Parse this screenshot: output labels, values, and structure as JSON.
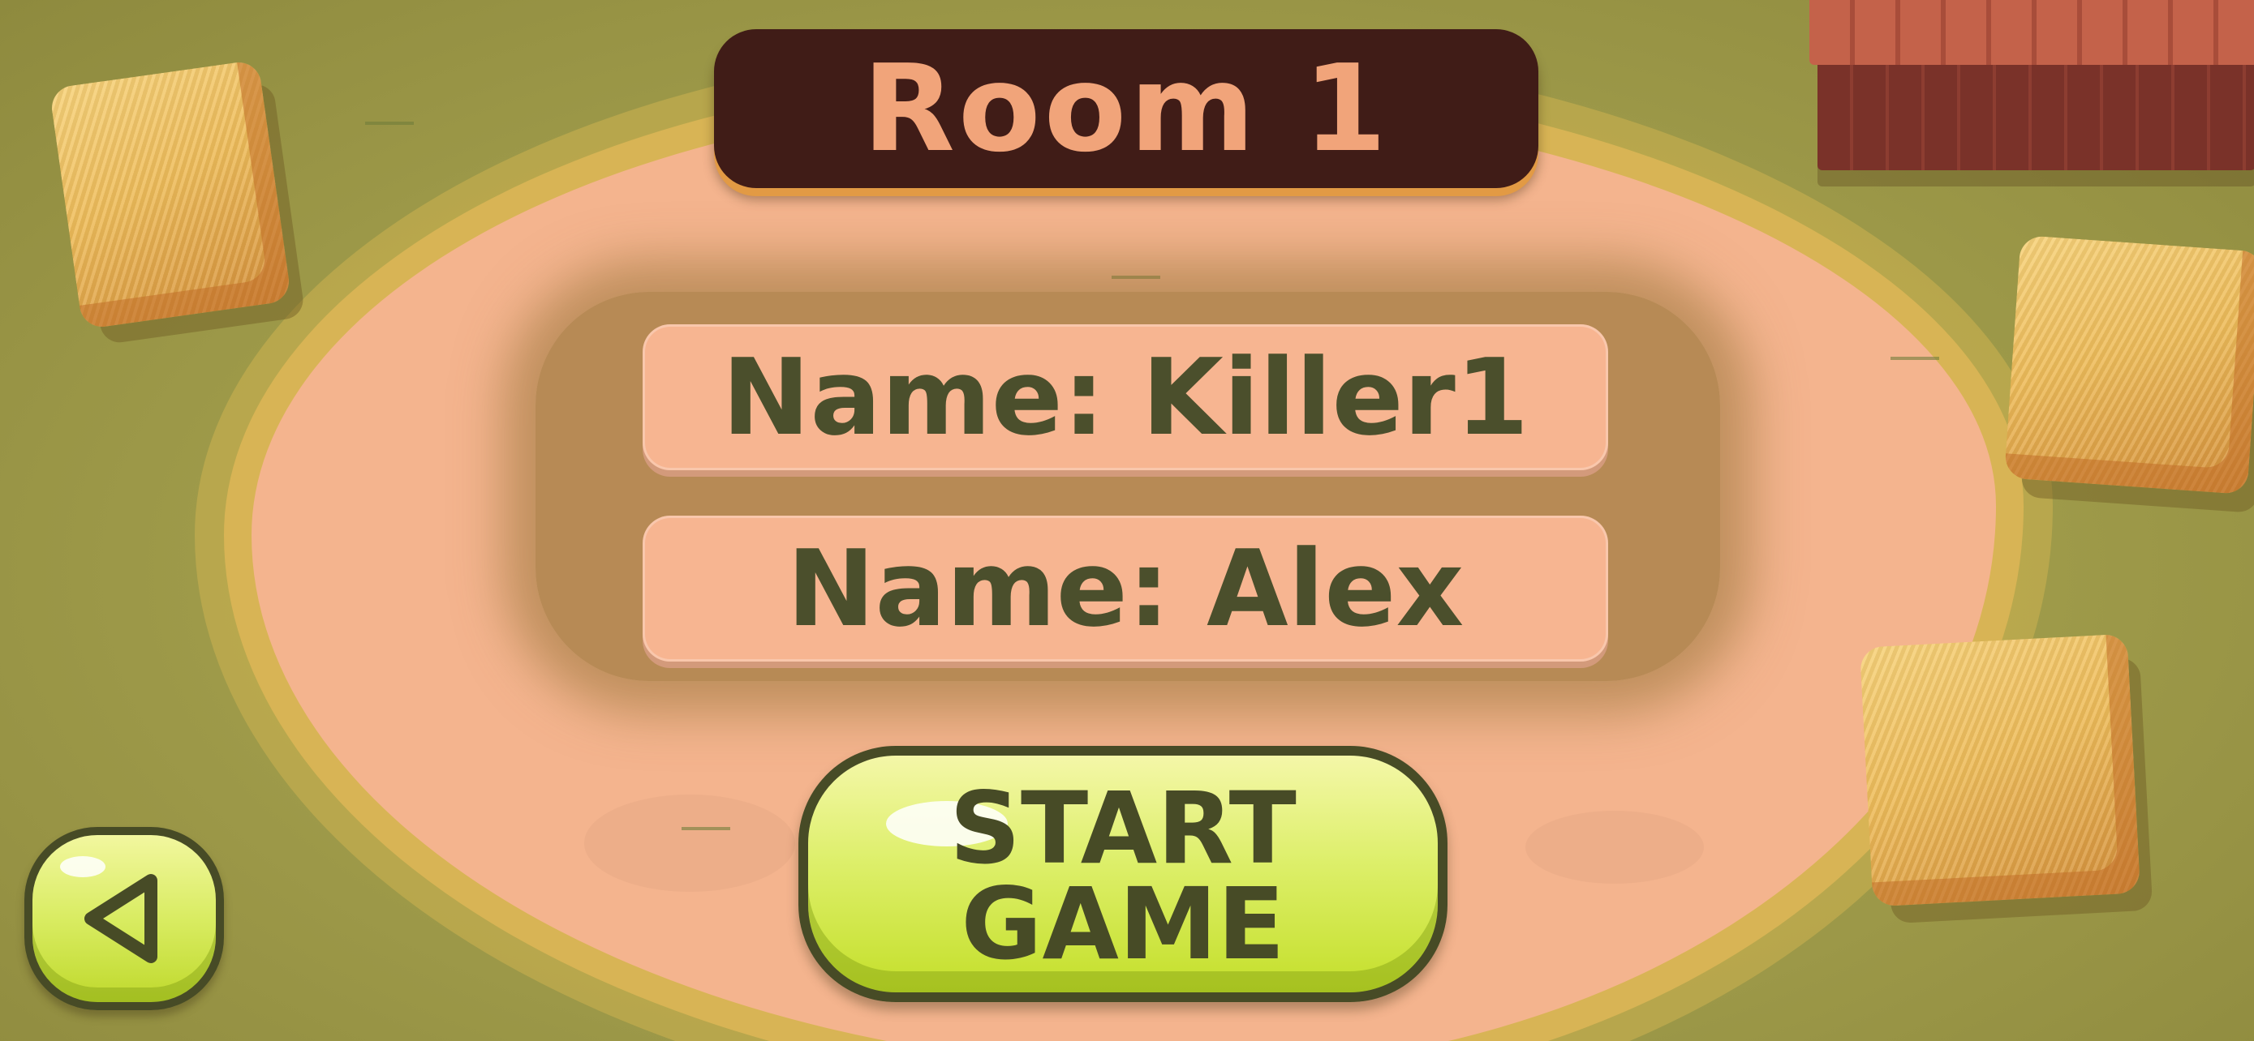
{
  "room": {
    "title": "Room 1"
  },
  "players": [
    {
      "label": "Name: Killer1"
    },
    {
      "label": "Name: Alex"
    }
  ],
  "buttons": {
    "start_label": "START\nGAME",
    "back_icon": "back-arrow-icon"
  },
  "colors": {
    "title_plate": "#401c17",
    "title_text": "#f1a47a",
    "player_card": "#f7b591",
    "player_text": "#4b4f2c",
    "button_green": "#d9ec62",
    "button_outline": "#474b26"
  }
}
